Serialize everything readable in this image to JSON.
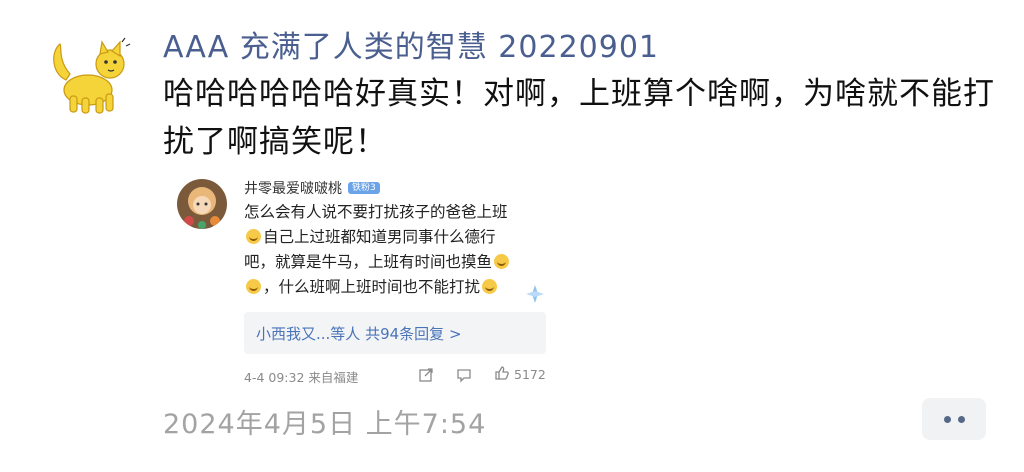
{
  "post": {
    "author": "AAA 充满了人类的智慧 20220901",
    "text": "哈哈哈哈哈哈好真实！对啊，上班算个啥啊，为啥就不能打扰了啊搞笑呢！",
    "timestamp": "2024年4月5日 上午7:54"
  },
  "quoted": {
    "username": "井零最爱啵啵桃",
    "badge": "铁粉3",
    "line1": "怎么会有人说不要打扰孩子的爸爸上班",
    "line2": "自己上过班都知道男同事什么德行",
    "line3": "吧，就算是牛马，上班有时间也摸鱼",
    "line4": "，什么班啊上班时间也不能打扰",
    "replies_text": "小西我又...等人",
    "replies_count": "共94条回复 >",
    "meta": "4-4 09:32 来自福建",
    "likes": "5172"
  },
  "colors": {
    "author": "#4a5f8f",
    "link": "#4a74b8",
    "muted": "#a3a3a3"
  },
  "icons": [
    "cat-avatar-icon",
    "share-icon",
    "comment-icon",
    "like-icon",
    "more-dots-icon"
  ]
}
